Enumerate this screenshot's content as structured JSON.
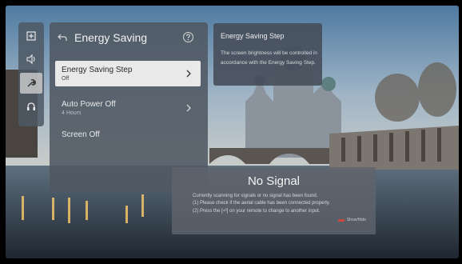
{
  "sidebar": {
    "items": [
      {
        "icon": "picture-icon"
      },
      {
        "icon": "sound-icon"
      },
      {
        "icon": "wrench-icon",
        "active": true
      },
      {
        "icon": "headset-icon"
      }
    ]
  },
  "panel": {
    "title": "Energy Saving",
    "items": [
      {
        "label": "Energy Saving Step",
        "value": "Off"
      },
      {
        "label": "Auto Power Off",
        "value": "4 Hours"
      },
      {
        "label": "Screen Off",
        "value": ""
      }
    ]
  },
  "tooltip": {
    "title": "Energy Saving Step",
    "body": "The screen brightness will be controlled in accordance with the Energy Saving Step."
  },
  "no_signal": {
    "title": "No Signal",
    "lines": [
      "Currently scanning for signals or no signal has been found.",
      "(1) Please check if the aerial cable has been connected properly.",
      "(2) Press the [⏎] on your remote to change to another input."
    ],
    "hide_label": "Show/Hide"
  },
  "colors": {
    "accent_red": "#d0463e",
    "focus": "#e9e9e9"
  }
}
